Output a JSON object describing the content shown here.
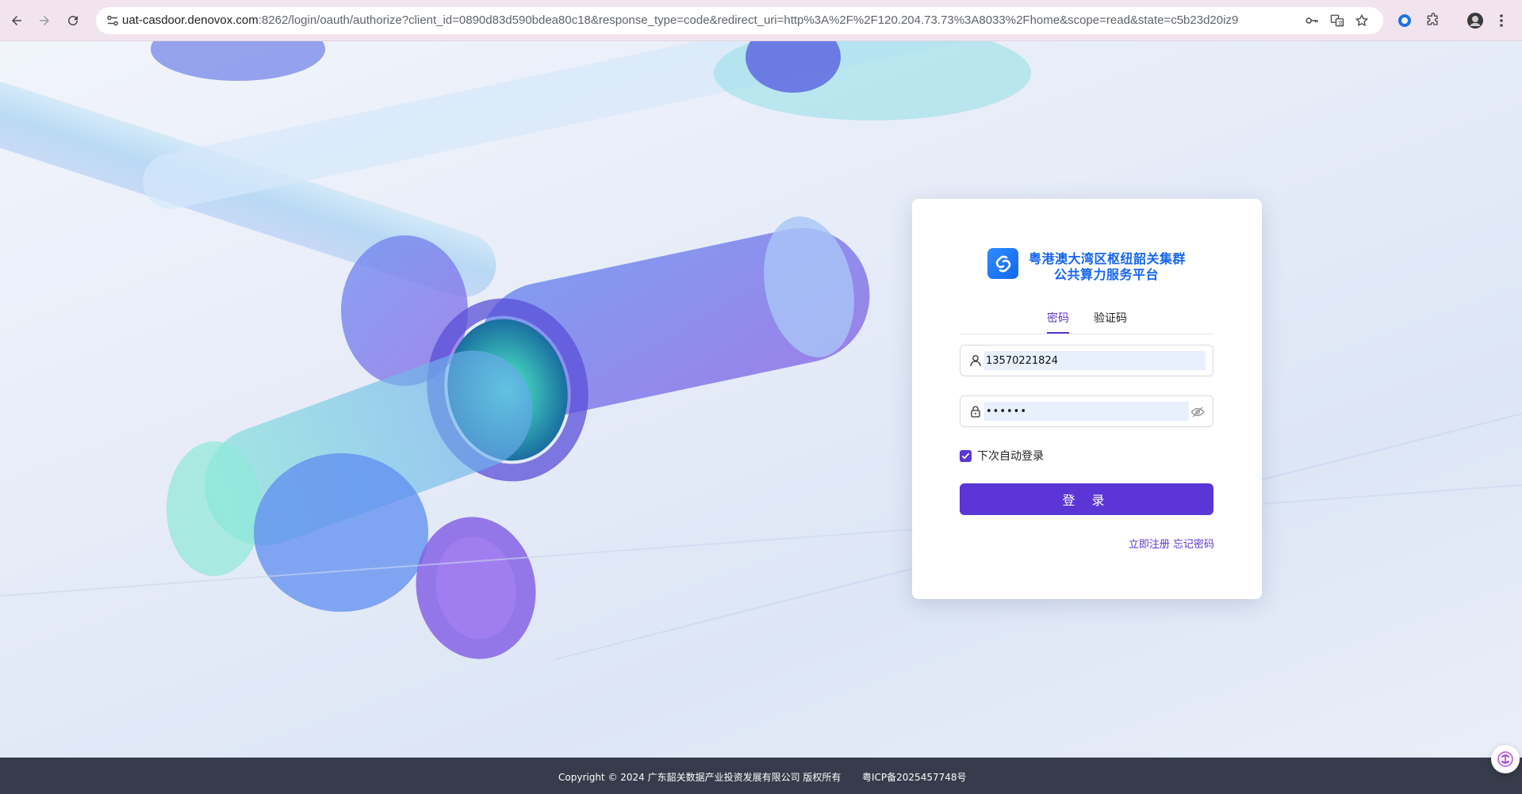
{
  "browser": {
    "url_host": "uat-casdoor.denovox.com",
    "url_rest": ":8262/login/oauth/authorize?client_id=0890d83d590bdea80c18&response_type=code&redirect_uri=http%3A%2F%2F120.204.73.73%3A8033%2Fhome&scope=read&state=c5b23d20iz9",
    "icons": [
      "back-icon",
      "forward-icon",
      "reload-icon",
      "site-info-icon",
      "key-icon",
      "translate-icon",
      "star-icon",
      "extension-circle-icon",
      "puzzle-icon",
      "profile-avatar-icon",
      "menu-dots-icon"
    ]
  },
  "login": {
    "logo_line1": "粤港澳大湾区枢纽韶关集群",
    "logo_line2": "公共算力服务平台",
    "tabs": [
      {
        "label": "密码",
        "active": true
      },
      {
        "label": "验证码",
        "active": false
      }
    ],
    "username_value": "13570221824",
    "password_value": "••••••",
    "remember_label": "下次自动登录",
    "remember_checked": true,
    "login_button": "登 录",
    "register_link": "立即注册",
    "forgot_link": "忘记密码"
  },
  "footer": {
    "copyright": "Copyright © 2024 广东韶关数据产业投资发展有限公司 版权所有",
    "icp": "粤ICP备2025457748号"
  },
  "colors": {
    "accent": "#5b35d5",
    "brand_blue": "#1565f0",
    "footer_bg": "#363c4b",
    "browser_bar": "#f1e4ef"
  }
}
